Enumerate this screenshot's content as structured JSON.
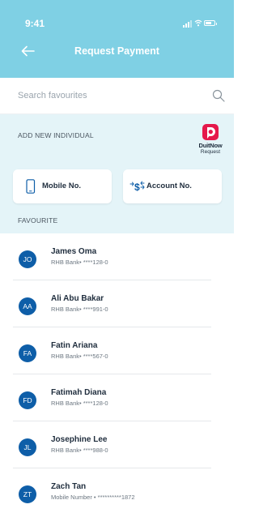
{
  "status_bar": {
    "time": "9:41"
  },
  "header": {
    "title": "Request Payment",
    "background_color": "#7fd0e4"
  },
  "search": {
    "placeholder": "Search favourites",
    "value": ""
  },
  "add_new": {
    "section_label": "ADD NEW INDIVIDUAL",
    "duitnow": {
      "name": "DuitNow",
      "subtitle": "Request",
      "brand_color": "#e5184b"
    },
    "options": [
      {
        "label": "Mobile No.",
        "icon": "mobile-phone-icon"
      },
      {
        "label": "Account No.",
        "icon": "account-transfer-icon"
      }
    ]
  },
  "favourites": {
    "section_label": "FAVOURITE",
    "avatar_color": "#0e5ea8",
    "items": [
      {
        "initials": "JO",
        "name": "James Oma",
        "detail": "RHB Bank• ****128-0"
      },
      {
        "initials": "AA",
        "name": "Ali Abu Bakar",
        "detail": "RHB Bank• ****991-0"
      },
      {
        "initials": "FA",
        "name": "Fatin Ariana",
        "detail": "RHB Bank• ****567-0"
      },
      {
        "initials": "FD",
        "name": "Fatimah Diana",
        "detail": "RHB Bank• ****128-0"
      },
      {
        "initials": "JL",
        "name": "Josephine Lee",
        "detail": "RHB Bank• ****988-0"
      },
      {
        "initials": "ZT",
        "name": "Zach Tan",
        "detail": "Mobile Number • **********1872"
      }
    ]
  }
}
